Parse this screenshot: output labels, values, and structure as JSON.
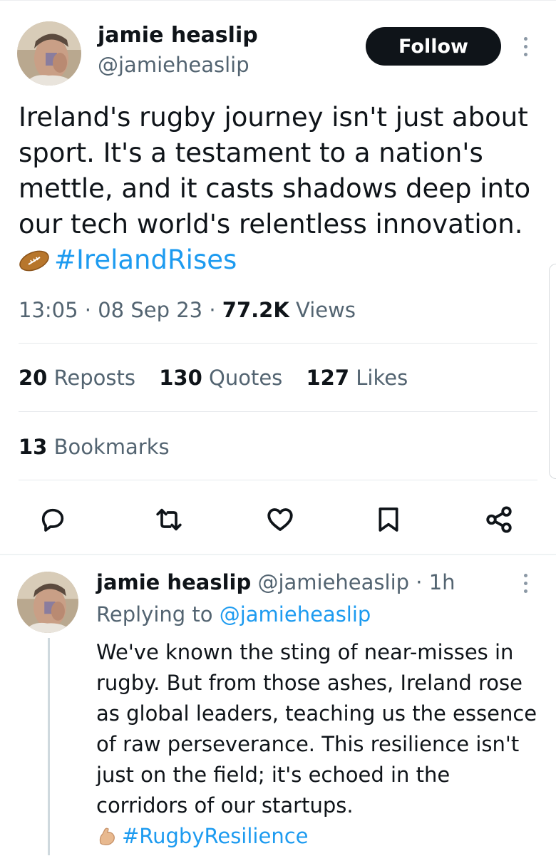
{
  "tweet": {
    "author_name": "jamie heaslip",
    "author_handle": "@jamieheaslip",
    "follow_label": "Follow",
    "text": "Ireland's rugby journey isn't just about sport. It's a testament to a nation's mettle, and it casts shadows deep into our tech world's relentless innovation.",
    "hashtag": "#IrelandRises",
    "emoji_icon": "rugby-ball-icon",
    "time": "13:05",
    "date": "08 Sep 23",
    "views_count": "77.2K",
    "views_label": "Views",
    "stats": {
      "reposts_count": "20",
      "reposts_label": "Reposts",
      "quotes_count": "130",
      "quotes_label": "Quotes",
      "likes_count": "127",
      "likes_label": "Likes",
      "bookmarks_count": "13",
      "bookmarks_label": "Bookmarks"
    },
    "actions": [
      "reply-icon",
      "repost-icon",
      "like-icon",
      "bookmark-icon",
      "share-icon"
    ]
  },
  "reply": {
    "author_name": "jamie heaslip",
    "author_handle": "@jamieheaslip",
    "age": "· 1h",
    "replying_prefix": "Replying to",
    "replying_handle": "@jamieheaslip",
    "text": "We've known the sting of near-misses in rugby. But from those ashes, Ireland rose as global leaders, teaching us the essence of raw perseverance. This resilience isn't just on the field; it's echoed in the corridors of our startups.",
    "hashtag": "#RugbyResilience",
    "emoji_icon": "flexed-biceps-icon"
  },
  "colors": {
    "text": "#0f1419",
    "secondary": "#536471",
    "link": "#1d9bf0",
    "follow_bg": "#0f1419",
    "divider": "#e6e9ec"
  }
}
